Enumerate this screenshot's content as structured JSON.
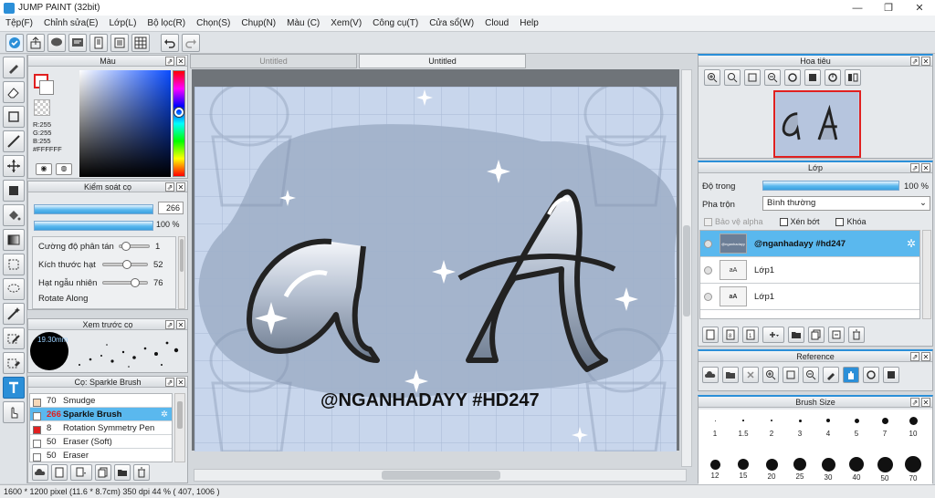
{
  "app": {
    "title": "JUMP PAINT (32bit)"
  },
  "window_controls": {
    "minimize": "—",
    "maximize": "❐",
    "close": "✕"
  },
  "menu": [
    "Tệp(F)",
    "Chỉnh sửa(E)",
    "Lớp(L)",
    "Bộ lọc(R)",
    "Chọn(S)",
    "Chụp(N)",
    "Màu (C)",
    "Xem(V)",
    "Công cụ(T)",
    "Cửa sổ(W)",
    "Cloud",
    "Help"
  ],
  "tabs": [
    {
      "label": "Untitled",
      "active": false
    },
    {
      "label": "Untitled",
      "active": true
    }
  ],
  "color_panel": {
    "title": "Màu",
    "r": "R:255",
    "g": "G:255",
    "b": "B:255",
    "hex": "#FFFFFF"
  },
  "brush_control": {
    "title": "Kiểm soát cọ",
    "size_value": "266",
    "opacity_value": "100 %",
    "sliders": [
      {
        "label": "Cường độ phân tán",
        "value": "1",
        "fraction": 0.1
      },
      {
        "label": "Kích thước hạt",
        "value": "52",
        "fraction": 0.52
      },
      {
        "label": "Hạt ngẫu nhiên",
        "value": "76",
        "fraction": 0.76
      }
    ],
    "cut_label": "Rotate Along"
  },
  "brush_preview": {
    "title": "Xem trước cọ",
    "size_label": "19.30mm"
  },
  "brush_list": {
    "title": "Cọ: Sparkle Brush",
    "items": [
      {
        "size": "70",
        "name": "Smudge",
        "color": "#f6d8b8",
        "selected": false
      },
      {
        "size": "266",
        "name": "Sparkle Brush",
        "color": "#ffffff",
        "selected": true
      },
      {
        "size": "8",
        "name": "Rotation Symmetry Pen",
        "color": "#e02020",
        "selected": false
      },
      {
        "size": "50",
        "name": "Eraser (Soft)",
        "color": "#ffffff",
        "selected": false
      },
      {
        "size": "50",
        "name": "Eraser",
        "color": "#ffffff",
        "selected": false
      }
    ]
  },
  "artwork": {
    "hashtag": "@NGANHADAYY #HD247",
    "letters": "aA"
  },
  "navigator": {
    "title": "Hoa tiêu"
  },
  "layers": {
    "title": "Lớp",
    "opacity_label": "Độ trong",
    "opacity_value": "100 %",
    "opacity_fraction": 1.0,
    "blend_label": "Pha trộn",
    "blend_value": "Bình thường",
    "chk_protect": "Bảo vệ alpha",
    "chk_clip": "Xén bớt",
    "chk_lock": "Khóa",
    "items": [
      {
        "name": "@nganhadayy #hd247",
        "thumb": "@nganhadayy",
        "selected": true
      },
      {
        "name": "Lớp1",
        "thumb": "aA",
        "selected": false
      },
      {
        "name": "Lớp1",
        "thumb": "aA",
        "selected": false
      }
    ]
  },
  "reference": {
    "title": "Reference"
  },
  "brush_size": {
    "title": "Brush Size",
    "row1": [
      "1",
      "1.5",
      "2",
      "3",
      "4",
      "5",
      "7",
      "10"
    ],
    "row2": [
      "12",
      "15",
      "20",
      "25",
      "30",
      "40",
      "50",
      "70"
    ]
  },
  "status": {
    "text": "1600 * 1200 pixel   (11.6 * 8.7cm)   350 dpi   44 %   ( 407, 1006 )"
  },
  "colors": {
    "accent": "#2b8fd8",
    "canvas_bg": "#c8d6ec",
    "blob": "#a4b4cc",
    "grid": "#9fb1cd"
  }
}
